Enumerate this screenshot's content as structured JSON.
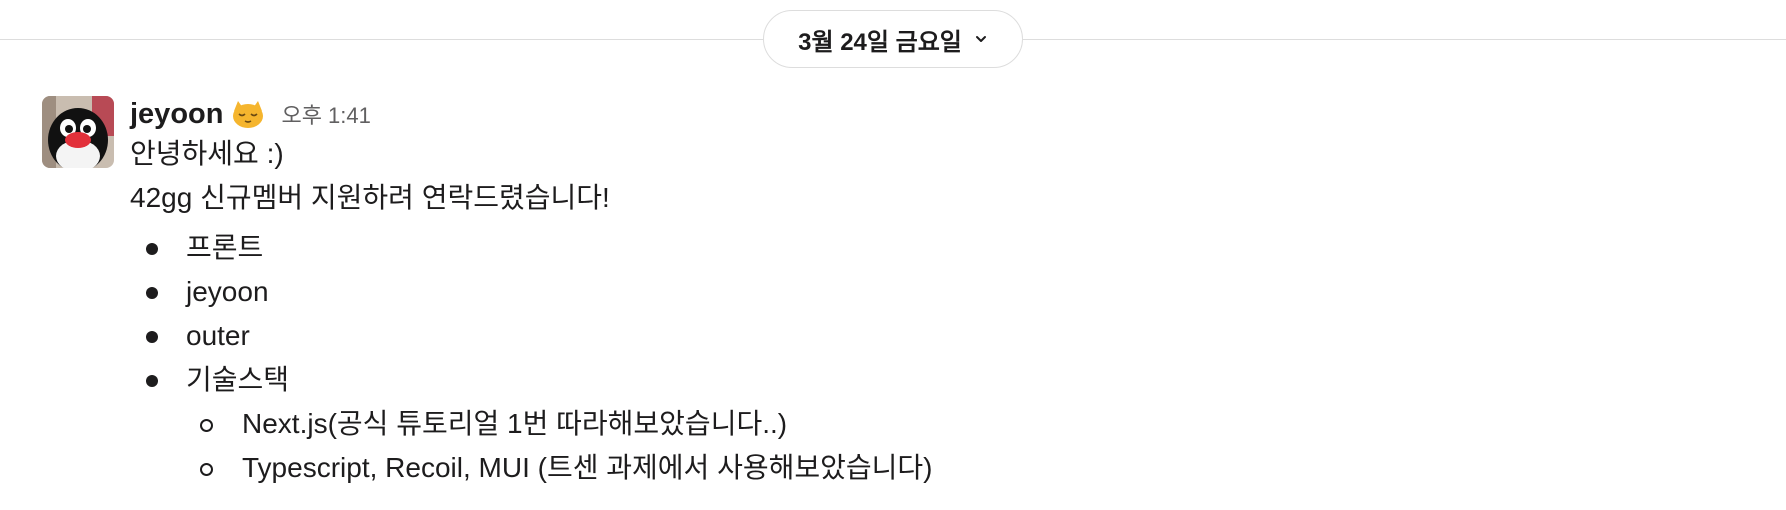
{
  "date_divider": {
    "label": "3월 24일 금요일",
    "chevron_icon": "chevron-down-icon"
  },
  "message": {
    "sender": "jeyoon",
    "status_emoji": "sleepy-cat-emoji",
    "timestamp": "오후 1:41",
    "lines": [
      "안녕하세요 :)",
      "42gg 신규멤버 지원하려 연락드렸습니다!"
    ],
    "bullets": [
      "프론트",
      "jeyoon",
      "outer",
      "기술스택"
    ],
    "sub_bullets": [
      "Next.js(공식 튜토리얼 1번 따라해보았습니다..)",
      "Typescript, Recoil, MUI (트센 과제에서 사용해보았습니다)"
    ]
  },
  "colors": {
    "text": "#1d1c1d",
    "muted": "#616061",
    "divider": "#dddddd"
  }
}
